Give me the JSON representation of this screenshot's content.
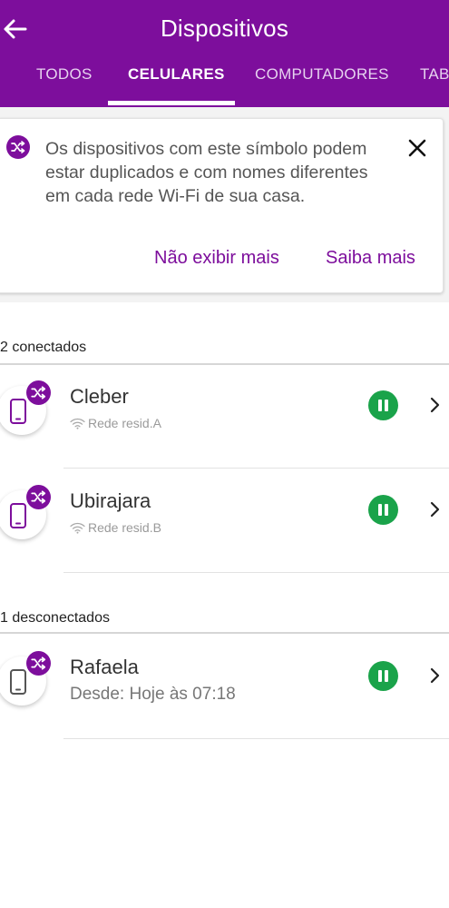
{
  "header": {
    "title": "Dispositivos",
    "tabs": [
      {
        "label": "TODOS"
      },
      {
        "label": "CELULARES"
      },
      {
        "label": "COMPUTADORES"
      },
      {
        "label": "TAB"
      }
    ],
    "active_tab": "CELULARES"
  },
  "notice": {
    "text": "Os dispositivos com este símbolo podem estar duplicados e com nomes diferentes em cada rede Wi-Fi de sua casa.",
    "dismiss_label": "Não exibir mais",
    "learn_label": "Saiba mais"
  },
  "sections": {
    "connected": "2 conectados",
    "disconnected": "1 desconectados"
  },
  "devices": [
    {
      "name": "Cleber",
      "network": "Rede resid.A"
    },
    {
      "name": "Ubirajara",
      "network": "Rede resid.B"
    },
    {
      "name": "Rafaela",
      "status": "Desde: Hoje às 07:18"
    }
  ],
  "colors": {
    "brand": "#7d0e9c",
    "pause_button": "#1aa34a",
    "link": "#7d0e9c"
  },
  "icons": [
    "back-arrow-icon",
    "shuffle-icon",
    "close-icon",
    "phone-icon",
    "wifi-icon",
    "pause-icon",
    "chevron-right-icon"
  ]
}
